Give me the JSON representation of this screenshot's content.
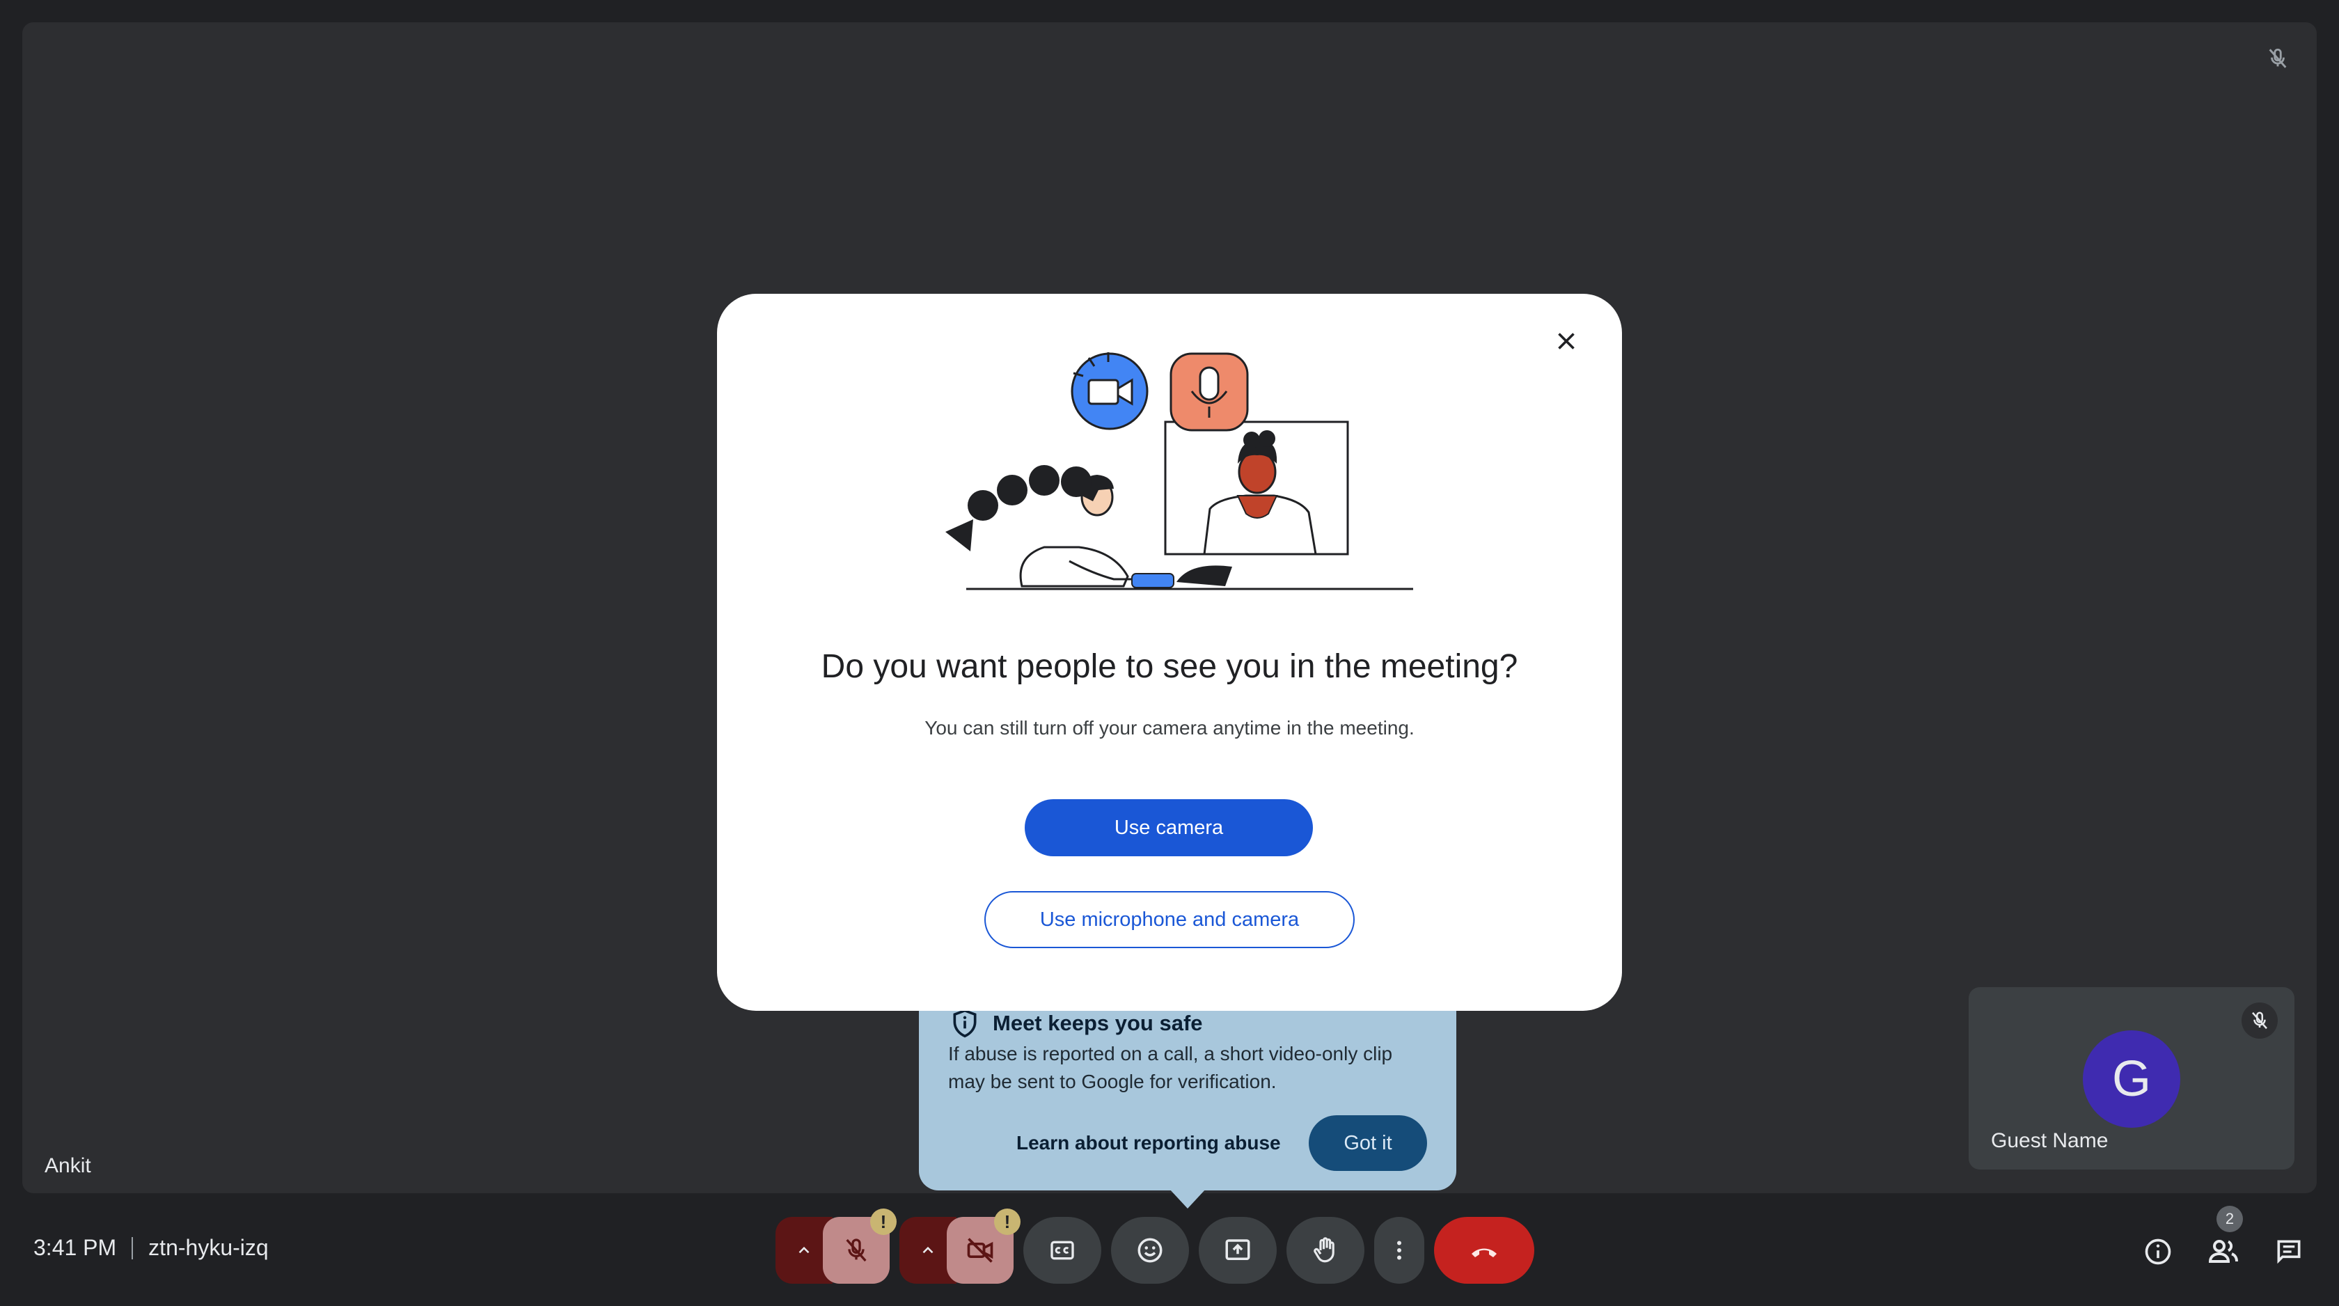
{
  "participants": {
    "main": {
      "name": "Ankit"
    },
    "guest": {
      "initial": "G",
      "name": "Guest Name"
    }
  },
  "dialog": {
    "title": "Do you want people to see you in the meeting?",
    "subtitle": "You can still turn off your camera anytime in the meeting.",
    "primary_button": "Use camera",
    "secondary_button": "Use microphone and camera"
  },
  "safety_card": {
    "title": "Meet keeps you safe",
    "body": "If abuse is reported on a call, a short video-only clip may be sent to Google for verification.",
    "link": "Learn about reporting abuse",
    "button": "Got it"
  },
  "bottom_bar": {
    "time": "3:41 PM",
    "meeting_code": "ztn-hyku-izq",
    "warning_mark": "!",
    "people_count": "2"
  },
  "icons": [
    "mic-off-icon",
    "videocam-off-icon",
    "closed-caption-icon",
    "emoji-icon",
    "present-icon",
    "raise-hand-icon",
    "more-vert-icon",
    "call-end-icon",
    "info-icon",
    "people-icon",
    "chat-icon",
    "close-icon",
    "shield-icon"
  ],
  "colors": {
    "primary": "#1a57d6",
    "end_call": "#c5221f",
    "avatar": "#3f2bb0",
    "safety_card": "#a8c7dc"
  }
}
